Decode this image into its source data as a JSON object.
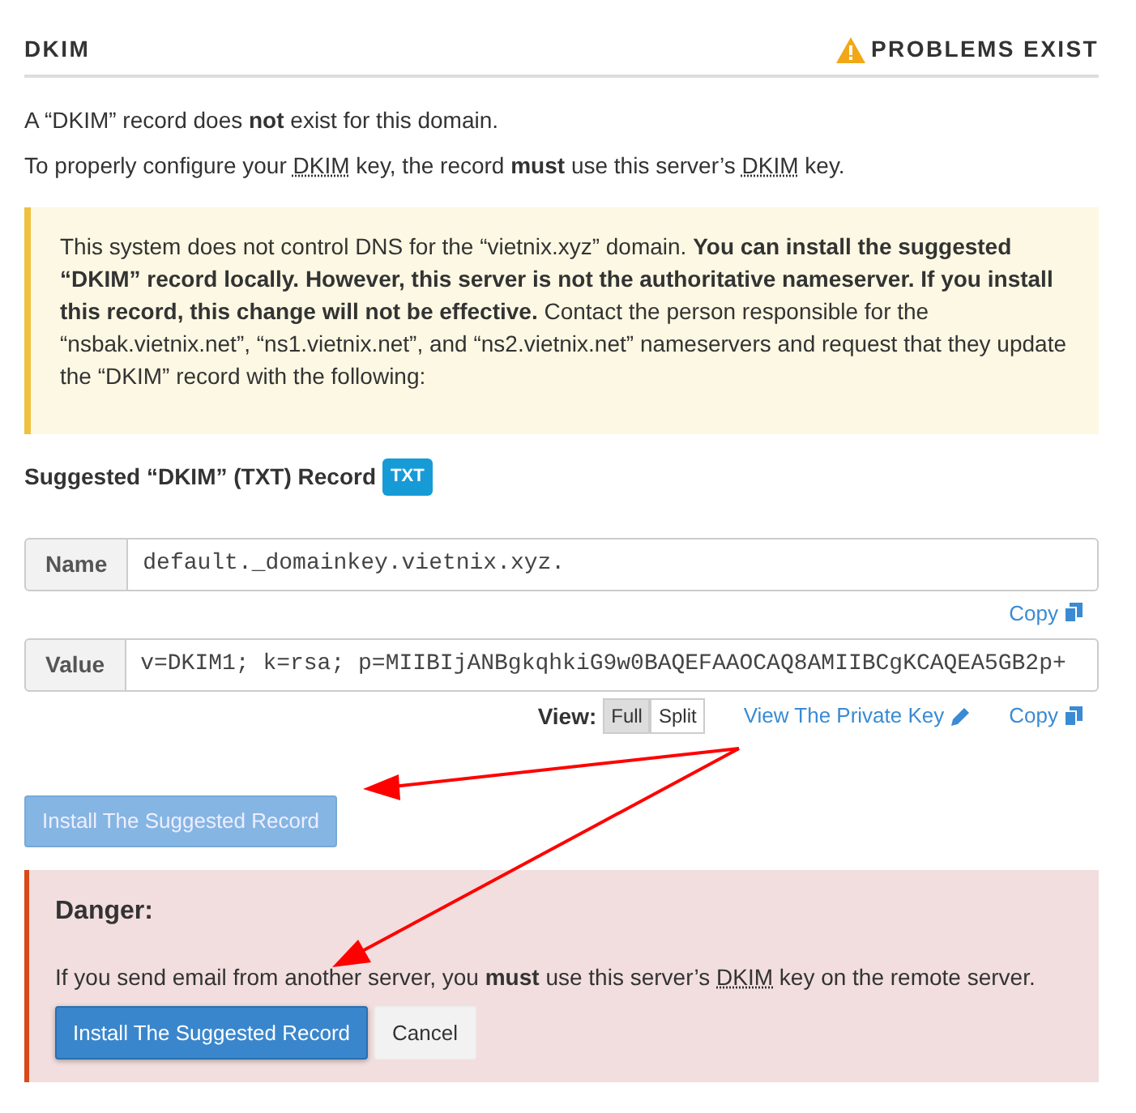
{
  "header": {
    "title": "DKIM",
    "status": "PROBLEMS EXIST"
  },
  "paragraphs": [
    [
      {
        "kind": "text",
        "text": "A “DKIM” record does "
      },
      {
        "kind": "bold",
        "text": "not"
      },
      {
        "kind": "text",
        "text": " exist for this domain."
      }
    ],
    [
      {
        "kind": "text",
        "text": "To properly configure your "
      },
      {
        "kind": "abbr",
        "text": "DKIM"
      },
      {
        "kind": "text",
        "text": " key, the record "
      },
      {
        "kind": "bold",
        "text": "must"
      },
      {
        "kind": "text",
        "text": " use this server’s "
      },
      {
        "kind": "abbr",
        "text": "DKIM"
      },
      {
        "kind": "text",
        "text": " key."
      }
    ]
  ],
  "warning": [
    {
      "kind": "text",
      "text": "This system does not control DNS for the “vietnix.xyz” domain. "
    },
    {
      "kind": "bold",
      "text": "You can install the suggested “DKIM” record locally. However, this server is not the authoritative nameserver. If you install this record, this change will not be effective."
    },
    {
      "kind": "text",
      "text": " Contact the person responsible for the “nsbak.vietnix.net”, “ns1.vietnix.net”, and “ns2.vietnix.net” nameservers and request that they update the “DKIM” record with the following:"
    }
  ],
  "record": {
    "heading": "Suggested “DKIM” (TXT) Record",
    "badge": "TXT"
  },
  "fields": [
    {
      "label": "Name",
      "value": "default._domainkey.vietnix.xyz."
    },
    {
      "label": "Value",
      "value": "v=DKIM1; k=rsa; p=MIIBIjANBgkqhkiG9w0BAQEFAAOCAQ8AMIIBCgKCAQEA5GB2p+"
    }
  ],
  "copy_links": [
    "Copy",
    "Copy"
  ],
  "view": {
    "label": "View:",
    "options": [
      {
        "label": "Full",
        "selected": true
      },
      {
        "label": "Split",
        "selected": false
      }
    ]
  },
  "private_key_link": "View The Private Key",
  "install_button": {
    "label": "Install The Suggested Record",
    "disabled": true
  },
  "danger": {
    "title": "Danger:",
    "text": [
      {
        "kind": "text",
        "text": "If you send email from another server, you "
      },
      {
        "kind": "bold",
        "text": "must"
      },
      {
        "kind": "text",
        "text": " use this server’s "
      },
      {
        "kind": "abbr",
        "text": "DKIM"
      },
      {
        "kind": "text",
        "text": " key on the remote server."
      }
    ],
    "buttons": [
      {
        "label": "Install The Suggested Record",
        "kind": "primary"
      },
      {
        "label": "Cancel",
        "kind": "secondary"
      }
    ]
  }
}
